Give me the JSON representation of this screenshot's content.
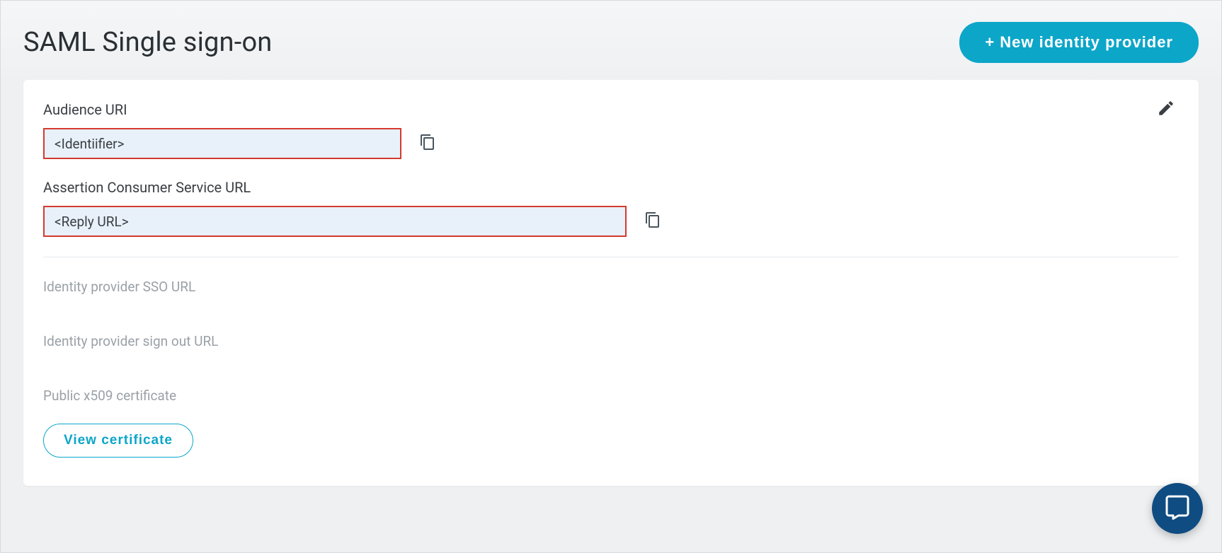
{
  "header": {
    "title": "SAML Single sign-on",
    "new_idp_label": "+ New identity provider"
  },
  "card": {
    "audience_uri": {
      "label": "Audience URI",
      "value": "<Identiifier>"
    },
    "acs_url": {
      "label": "Assertion Consumer Service URL",
      "value": "<Reply URL>"
    },
    "idp_sso_url": {
      "label": "Identity provider SSO URL"
    },
    "idp_signout_url": {
      "label": "Identity provider sign out URL"
    },
    "public_cert": {
      "label": "Public x509 certificate",
      "button": "View certificate"
    }
  }
}
